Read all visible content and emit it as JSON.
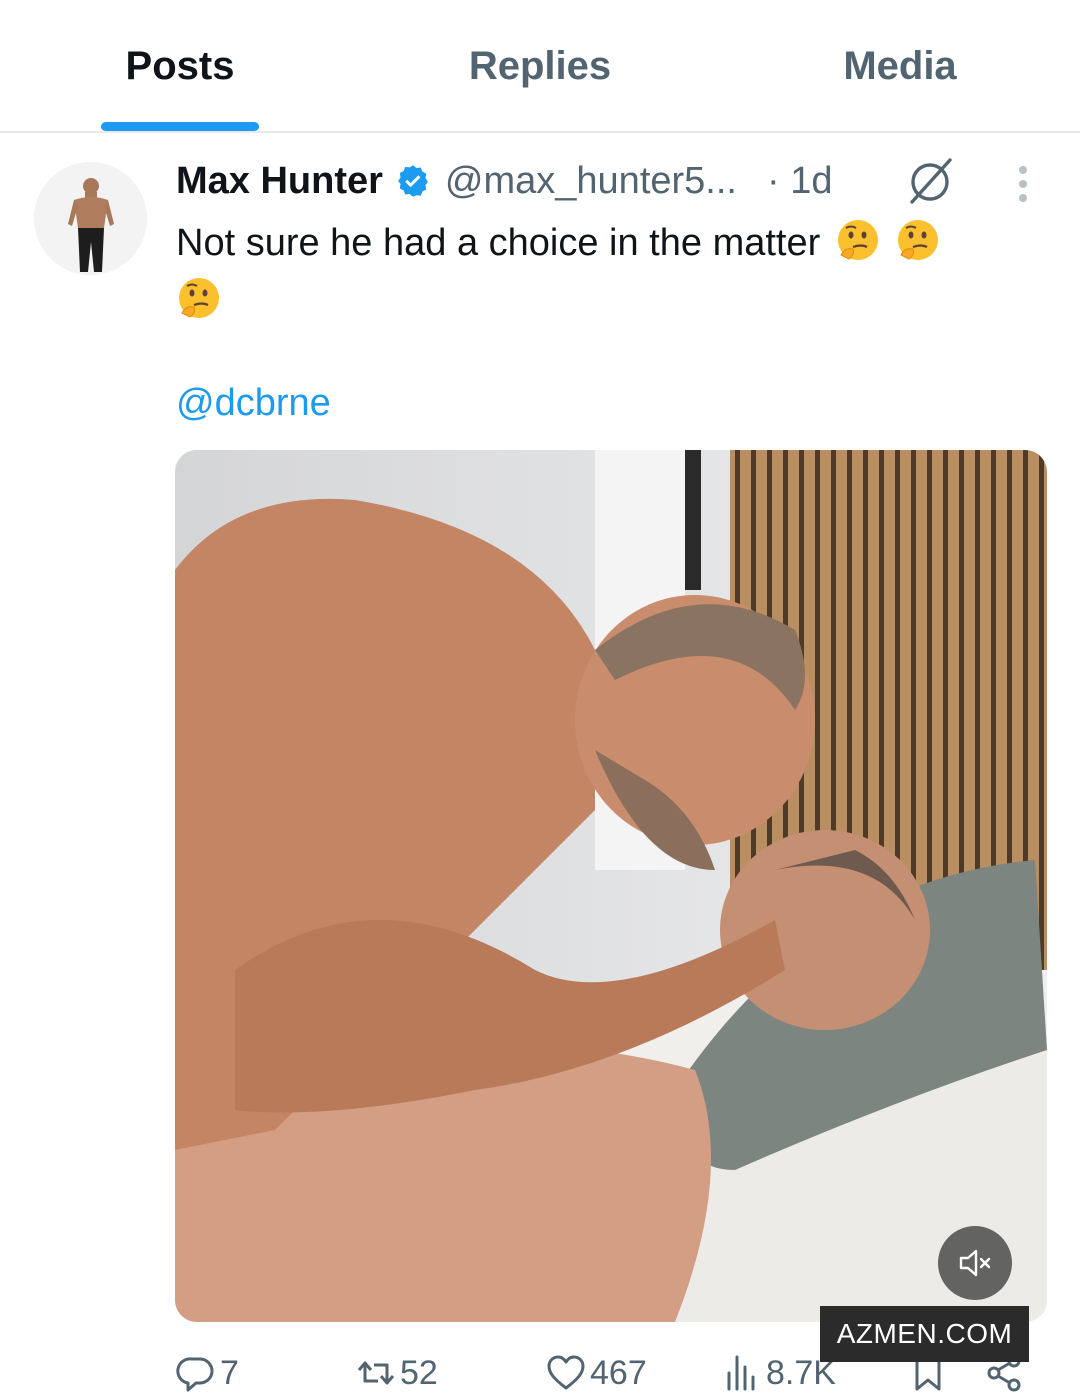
{
  "tabs": [
    {
      "label": "Posts",
      "active": true
    },
    {
      "label": "Replies",
      "active": false
    },
    {
      "label": "Media",
      "active": false
    }
  ],
  "post": {
    "author_name": "Max Hunter",
    "handle": "@max_hunter5...",
    "time": "· 1d",
    "text": "Not sure he had a choice in the matter",
    "emojis": [
      "thinking-face",
      "thinking-face",
      "thinking-face"
    ],
    "mention": "@dcbrne",
    "media": {
      "type": "video",
      "muted": true
    }
  },
  "actions": {
    "replies": "7",
    "reposts": "52",
    "likes": "467",
    "views": "8.7K"
  },
  "watermark": "AZMEN.COM",
  "colors": {
    "accent": "#1d9bf0",
    "text_primary": "#0f1419",
    "text_secondary": "#536471",
    "divider": "#e7e9ea"
  }
}
